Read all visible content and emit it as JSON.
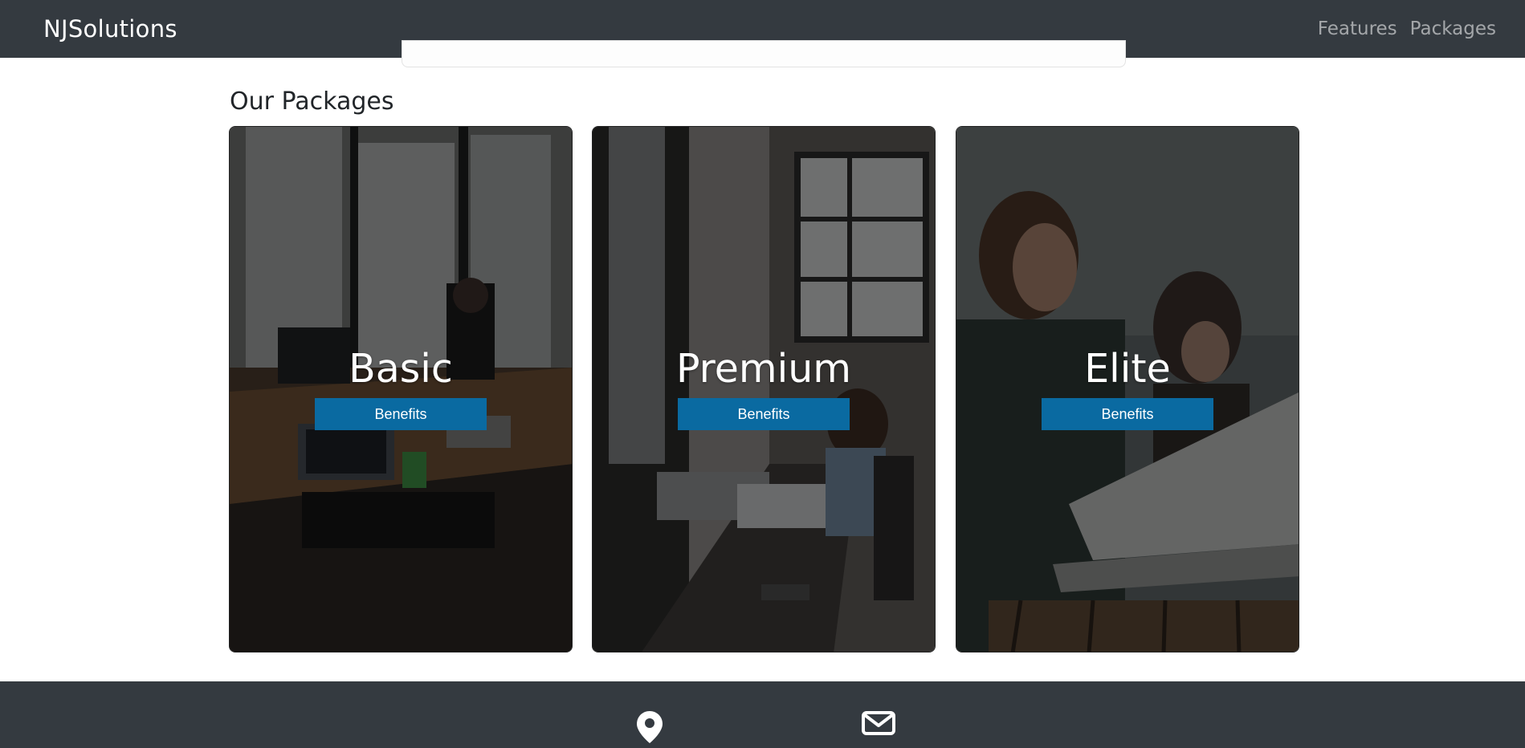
{
  "navbar": {
    "brand": "NJSolutions",
    "links": [
      {
        "label": "Features"
      },
      {
        "label": "Packages"
      }
    ]
  },
  "packages": {
    "title": "Our Packages",
    "cards": [
      {
        "title": "Basic",
        "button_label": "Benefits"
      },
      {
        "title": "Premium",
        "button_label": "Benefits"
      },
      {
        "title": "Elite",
        "button_label": "Benefits"
      }
    ]
  },
  "footer": {
    "icons": [
      "map-marker-icon",
      "envelope-icon"
    ]
  },
  "colors": {
    "navbar_bg": "#343a40",
    "button_bg": "#0a6aa1",
    "footer_bg": "#343a40"
  }
}
